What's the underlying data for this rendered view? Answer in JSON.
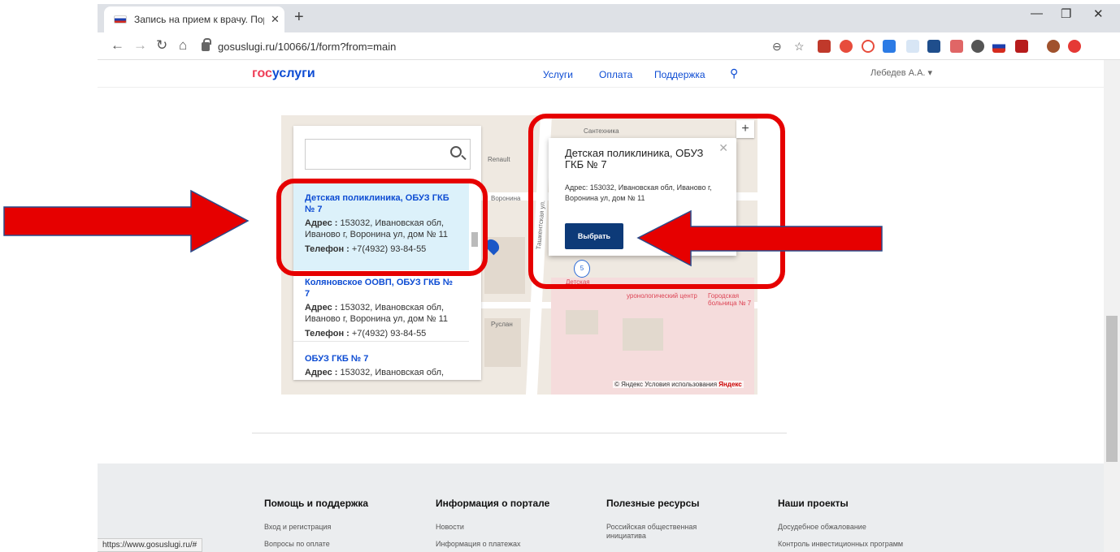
{
  "browser": {
    "tab_title": "Запись на прием к врачу. Порт",
    "url": "gosuslugi.ru/10066/1/form?from=main",
    "status_url": "https://www.gosuslugi.ru/#"
  },
  "header": {
    "logo_a": "гос",
    "logo_b": "услуги",
    "nav": [
      "Услуги",
      "Оплата",
      "Поддержка"
    ],
    "user": "Лебедев А.А. ▾"
  },
  "sidebar": {
    "items": [
      {
        "title": "Детская поликлиника, ОБУЗ ГКБ № 7",
        "addr_key": "Адрес :",
        "addr": "153032, Ивановская обл, Иваново г, Воронина ул, дом № 11",
        "phone_key": "Телефон :",
        "phone": "+7(4932) 93-84-55"
      },
      {
        "title": "Коляновское ООВП, ОБУЗ ГКБ № 7",
        "addr_key": "Адрес :",
        "addr": "153032, Ивановская обл, Иваново г, Воронина ул, дом № 11",
        "phone_key": "Телефон :",
        "phone": "+7(4932) 93-84-55"
      },
      {
        "title": "ОБУЗ ГКБ № 7",
        "addr_key": "Адрес :",
        "addr": "153032, Ивановская обл,"
      }
    ]
  },
  "popup": {
    "title": "Детская поликлиника, ОБУЗ ГКБ № 7",
    "address": "Адрес: 153032, Ивановская обл, Иваново г, Воронина ул, дом № 11",
    "button": "Выбрать"
  },
  "map": {
    "labels": [
      "Сантехника",
      "Renault",
      "Воронина",
      "Руслан",
      "уронологический центр",
      "Городская больница № 7",
      "Детская",
      "Ташкентская ул."
    ],
    "cluster_count": "5",
    "copyright": "© Яндекс Условия использования",
    "brand": "Яндекс"
  },
  "footer": {
    "columns": [
      {
        "head": "Помощь и поддержка",
        "links": [
          "Вход и регистрация",
          "Вопросы по оплате"
        ]
      },
      {
        "head": "Информация о портале",
        "links": [
          "Новости",
          "Информация о платежах"
        ]
      },
      {
        "head": "Полезные ресурсы",
        "links": [
          "Российская общественная инициатива"
        ]
      },
      {
        "head": "Наши проекты",
        "links": [
          "Досудебное обжалование",
          "Контроль инвестиционных программ"
        ]
      }
    ]
  },
  "colors": {
    "accent": "#0d4cd3",
    "highlight": "#e60000",
    "button": "#0d3a78"
  }
}
